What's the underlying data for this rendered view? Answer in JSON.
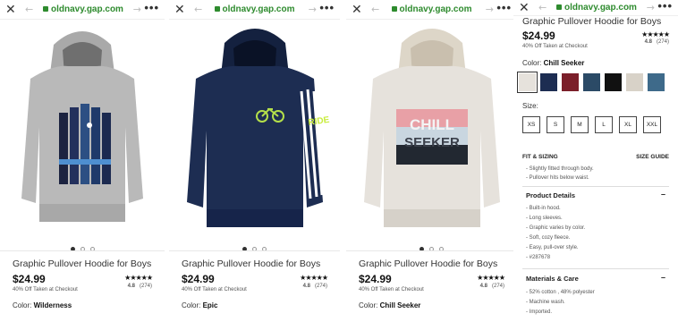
{
  "browser": {
    "url": "oldnavy.gap.com",
    "close_icon": "close-icon",
    "back_icon": "back-arrow-icon",
    "forward_icon": "forward-arrow-icon",
    "menu_icon": "more-icon"
  },
  "cards": [
    {
      "title": "Graphic Pullover Hoodie for Boys",
      "price": "$24.99",
      "promo": "40% Off Taken at Checkout",
      "stars": "★★★★★",
      "rating": "4.8",
      "reviews": "(274)",
      "color_label": "Color:",
      "color_value": "Wilderness",
      "hoodie_color": "#b9b9b9"
    },
    {
      "title": "Graphic Pullover Hoodie for Boys",
      "price": "$24.99",
      "promo": "40% Off Taken at Checkout",
      "stars": "★★★★★",
      "rating": "4.8",
      "reviews": "(274)",
      "color_label": "Color:",
      "color_value": "Epic",
      "hoodie_color": "#1d2d52",
      "graphic_text": "RIDE"
    },
    {
      "title": "Graphic Pullover Hoodie for Boys",
      "price": "$24.99",
      "promo": "40% Off Taken at Checkout",
      "stars": "★★★★★",
      "rating": "4.8",
      "reviews": "(274)",
      "color_label": "Color:",
      "color_value": "Chill Seeker",
      "hoodie_color": "#e6e2dc",
      "graphic_line1": "CHILL",
      "graphic_line2": "SEEKER"
    }
  ],
  "detail": {
    "title": "Graphic Pullover Hoodie for Boys",
    "price": "$24.99",
    "promo": "40% Off Taken at Checkout",
    "stars": "★★★★★",
    "rating": "4.8",
    "reviews": "(274)",
    "color_label": "Color:",
    "color_value": "Chill Seeker",
    "swatch_colors": [
      "#e6e2dc",
      "#1d2d52",
      "#7b1f2a",
      "#2b4a66",
      "#111111",
      "#d8d2c8",
      "#3e6a8a",
      "#f0f0f0"
    ],
    "size_label": "Size:",
    "sizes": [
      "XS",
      "S",
      "M",
      "L",
      "XL",
      "XXL"
    ],
    "fit_label": "FIT & SIZING",
    "size_guide": "SIZE GUIDE",
    "fit_bullets": [
      "Slightly fitted through body.",
      "Pullover hits below waist."
    ],
    "product_details_label": "Product Details",
    "product_details": [
      "Built-in hood.",
      "Long sleeves.",
      "Graphic varies by color.",
      "Soft, cozy fleece.",
      "Easy, pull-over style.",
      "#287678"
    ],
    "materials_label": "Materials & Care",
    "materials": [
      "52% cotton , 48% polyester",
      "Machine wash.",
      "Imported."
    ],
    "collapse_symbol": "–"
  }
}
